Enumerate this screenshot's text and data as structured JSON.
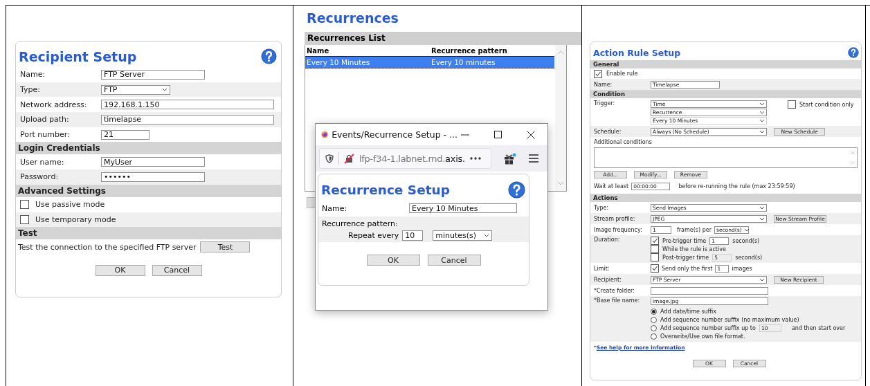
{
  "recipient_setup": {
    "title": "Recipient Setup",
    "sections": [
      {
        "rows": [
          {
            "kind": "text",
            "label": "Name:",
            "value": "FTP Server"
          },
          {
            "kind": "select",
            "label": "Type:",
            "value": "FTP"
          },
          {
            "kind": "text",
            "label": "Network address:",
            "value": "192.168.1.150"
          },
          {
            "kind": "text",
            "label": "Upload path:",
            "value": "timelapse"
          },
          {
            "kind": "text",
            "label": "Port number:",
            "value": "21"
          }
        ]
      },
      {
        "heading": "Login Credentials",
        "rows": [
          {
            "kind": "text",
            "label": "User name:",
            "value": "MyUser"
          },
          {
            "kind": "password",
            "label": "Password:",
            "value": "••••••"
          }
        ]
      },
      {
        "heading": "Advanced Settings",
        "rows": [
          {
            "kind": "checkbox",
            "label": "Use passive mode",
            "checked": false
          },
          {
            "kind": "checkbox",
            "label": "Use temporary mode",
            "checked": false
          }
        ]
      },
      {
        "heading": "Test",
        "rows": [
          {
            "kind": "button",
            "label": "Test the connection to the specified FTP server",
            "button": "Test"
          }
        ]
      }
    ],
    "buttons": [
      "OK",
      "Cancel"
    ]
  },
  "recurrences": {
    "title": "Recurrences",
    "list_title": "Recurrences List",
    "columns": [
      "Name",
      "Recurrence pattern"
    ],
    "rows": [
      {
        "cells": [
          "Every 10 Minutes",
          "Every 10 minutes"
        ],
        "selected": true
      }
    ]
  },
  "popup_window": {
    "title": "Events/Recurrence Setup - ...",
    "url_prefix": "lfp-f34-1.labnet.rnd.",
    "url_domain": "axis.",
    "dialog": {
      "title": "Recurrence Setup",
      "name_label": "Name:",
      "name_value": "Every 10 Minutes",
      "pattern_label": "Recurrence pattern:",
      "repeat_label": "Repeat every",
      "repeat_value": "10",
      "unit": "minutes(s)",
      "buttons": [
        "OK",
        "Cancel"
      ]
    }
  },
  "action_rule": {
    "title": "Action Rule Setup",
    "general": {
      "heading": "General",
      "enable_label": "Enable rule",
      "enabled": true,
      "name_label": "Name:",
      "name_value": "Timelapse"
    },
    "condition": {
      "heading": "Condition",
      "trigger_label": "Trigger:",
      "trigger_selects": [
        {
          "value": "Time",
          "disabled": false
        },
        {
          "value": "Recurrence",
          "disabled": false
        },
        {
          "value": "Every 10 Minutes",
          "disabled": true
        }
      ],
      "start_condition_label": "Start condition only",
      "start_condition_only": false,
      "schedule_label": "Schedule:",
      "schedule_value": "Always (No Schedule)",
      "schedule_button": "New Schedule",
      "additional_label": "Additional conditions",
      "buttons": [
        "Add...",
        "Modify...",
        "Remove"
      ],
      "wait_label": "Wait at least",
      "wait_value": "00:00:00",
      "wait_note": "before re-running the rule (max 23:59:59)"
    },
    "actions": {
      "heading": "Actions",
      "type_label": "Type:",
      "type_value": "Send Images",
      "stream_label": "Stream profile:",
      "stream_value": "JPEG",
      "stream_button": "New Stream Profile",
      "freq_label": "Image frequency:",
      "freq_value": "1",
      "freq_mid": "frame(s) per",
      "freq_unit": "second(s)",
      "duration_label": "Duration:",
      "duration_options": [
        {
          "label": "Pre-trigger time",
          "checked": true,
          "value": "1",
          "unit": "second(s)",
          "field_disabled": false
        },
        {
          "label": "While the rule is active",
          "checked": false
        },
        {
          "label": "Post-trigger time",
          "checked": false,
          "value": "5",
          "unit": "second(s)",
          "field_disabled": true
        }
      ],
      "limit_label": "Limit:",
      "limit_checked": true,
      "limit_text": "Send only the first",
      "limit_value": "1",
      "limit_unit": "images",
      "recipient_label": "Recipient:",
      "recipient_value": "FTP Server",
      "recipient_button": "New Recipient",
      "folder_label": "*Create folder:",
      "filename_label": "*Base file name:",
      "filename_value": "image.jpg",
      "suffix_options": [
        {
          "label": "Add date/time suffix",
          "selected": true
        },
        {
          "label": "Add sequence number suffix (no maximum value)",
          "selected": false
        },
        {
          "label": "Add sequence number suffix up to",
          "selected": false,
          "value": "10",
          "after": "and then start over"
        },
        {
          "label": "Overwrite/Use own file format.",
          "selected": false
        }
      ]
    },
    "help_star": "*",
    "help_link": "See help for more information",
    "buttons": [
      "OK",
      "Cancel"
    ]
  }
}
